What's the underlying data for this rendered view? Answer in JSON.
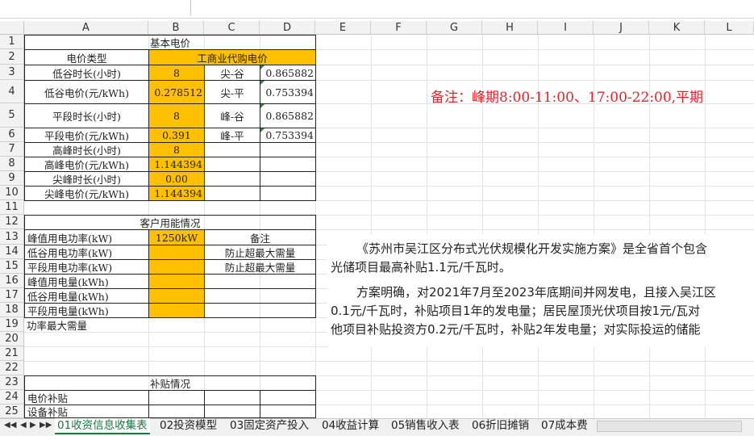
{
  "columns": [
    "A",
    "B",
    "C",
    "D",
    "E",
    "F",
    "G",
    "H",
    "I",
    "J",
    "K",
    "L"
  ],
  "rows": [
    "1",
    "2",
    "3",
    "4",
    "5",
    "6",
    "7",
    "8",
    "9",
    "10",
    "11",
    "12",
    "13",
    "14",
    "15",
    "16",
    "17",
    "18",
    "19",
    "20",
    "21",
    "22",
    "23",
    "24",
    "25"
  ],
  "cells": {
    "a1": "基本电价",
    "a2": "电价类型",
    "b2": "工商业代购电价",
    "a3": "低谷时长(小时)",
    "b3": "8",
    "c3": "尖-谷",
    "d3": "0.865882",
    "a4": "低谷电价(元/kWh)",
    "b4": "0.278512",
    "c4": "尖-平",
    "d4": "0.753394",
    "a5": "平段时长(小时)",
    "b5": "8",
    "c5": "峰-谷",
    "d5": "0.865882",
    "a6": "平段电价(元/kWh)",
    "b6": "0.391",
    "c6": "峰-平",
    "d6": "0.753394",
    "a7": "高峰时长(小时)",
    "b7": "8",
    "a8": "高峰电价(元/kWh)",
    "b8": "1.144394",
    "a9": "尖峰时长(小时)",
    "b9": "0.00",
    "a10": "尖峰电价(元/kWh)",
    "b10": "1.144394",
    "a12": "客户用能情况",
    "a13": "峰值用电功率(kW)",
    "b13": "1250kW",
    "c13": "备注",
    "a14": "低谷用电功率(kW)",
    "c14": "防止超最大需量",
    "a15": "平段用电功率(kW)",
    "c15": "防止超最大需量",
    "a16": "峰值用电量(kWh)",
    "a17": "低谷用电量(kWh)",
    "a18": "平段用电量(kWh)",
    "a19": "功率最大需量",
    "a23": "补贴情况",
    "a24": "电价补贴",
    "a25": "设备补贴"
  },
  "note": "备注：峰期8:00-11:00、17:00-22:00,平期",
  "paragraphs": {
    "p1_line1": "《苏州市吴江区分布式光伏规模化开发实施方案》是全省首个包含",
    "p1_line2": "光储项目最高补贴1.1元/千瓦时。",
    "p2_line1": "方案明确，对2021年7月至2023年底期间并网发电，且接入吴江区",
    "p2_line2": "0.1元/千瓦时，补贴项目1年的发电量；居民屋顶光伏项目按1元/瓦对",
    "p2_line3": "他项目补贴投资方0.2元/千瓦时，补贴2年发电量；对实际投运的储能"
  },
  "sheet_tabs": [
    "01收资信息收集表",
    "02投资模型",
    "03固定资产投入",
    "04收益计算",
    "05销售收入表",
    "06折旧摊销",
    "07成本费"
  ],
  "active_tab": "01收资信息收集表",
  "nav": [
    "◀◀",
    "◀",
    "▶",
    "▶▶"
  ],
  "colors": {
    "highlight": "#ffc000",
    "note_red": "#e8232a",
    "accent": "#217346"
  }
}
